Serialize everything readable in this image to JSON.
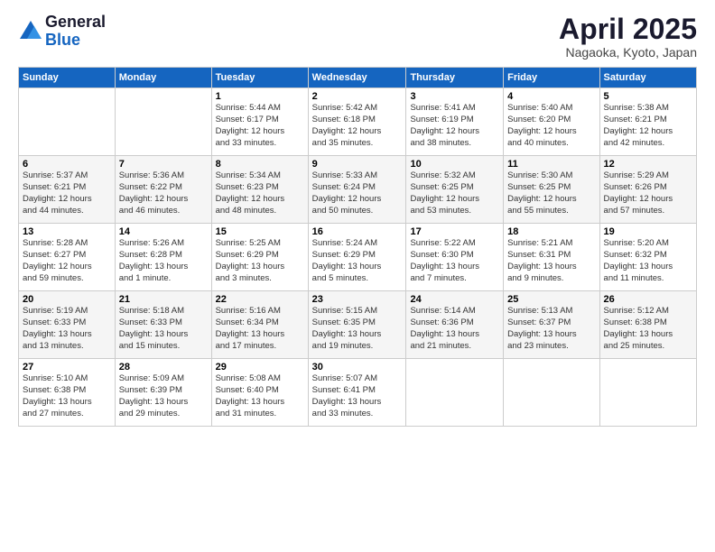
{
  "logo": {
    "general": "General",
    "blue": "Blue"
  },
  "header": {
    "title": "April 2025",
    "location": "Nagaoka, Kyoto, Japan"
  },
  "weekdays": [
    "Sunday",
    "Monday",
    "Tuesday",
    "Wednesday",
    "Thursday",
    "Friday",
    "Saturday"
  ],
  "weeks": [
    [
      null,
      null,
      {
        "day": "1",
        "sunrise": "Sunrise: 5:44 AM",
        "sunset": "Sunset: 6:17 PM",
        "daylight": "Daylight: 12 hours",
        "minutes": "and 33 minutes."
      },
      {
        "day": "2",
        "sunrise": "Sunrise: 5:42 AM",
        "sunset": "Sunset: 6:18 PM",
        "daylight": "Daylight: 12 hours",
        "minutes": "and 35 minutes."
      },
      {
        "day": "3",
        "sunrise": "Sunrise: 5:41 AM",
        "sunset": "Sunset: 6:19 PM",
        "daylight": "Daylight: 12 hours",
        "minutes": "and 38 minutes."
      },
      {
        "day": "4",
        "sunrise": "Sunrise: 5:40 AM",
        "sunset": "Sunset: 6:20 PM",
        "daylight": "Daylight: 12 hours",
        "minutes": "and 40 minutes."
      },
      {
        "day": "5",
        "sunrise": "Sunrise: 5:38 AM",
        "sunset": "Sunset: 6:21 PM",
        "daylight": "Daylight: 12 hours",
        "minutes": "and 42 minutes."
      }
    ],
    [
      {
        "day": "6",
        "sunrise": "Sunrise: 5:37 AM",
        "sunset": "Sunset: 6:21 PM",
        "daylight": "Daylight: 12 hours",
        "minutes": "and 44 minutes."
      },
      {
        "day": "7",
        "sunrise": "Sunrise: 5:36 AM",
        "sunset": "Sunset: 6:22 PM",
        "daylight": "Daylight: 12 hours",
        "minutes": "and 46 minutes."
      },
      {
        "day": "8",
        "sunrise": "Sunrise: 5:34 AM",
        "sunset": "Sunset: 6:23 PM",
        "daylight": "Daylight: 12 hours",
        "minutes": "and 48 minutes."
      },
      {
        "day": "9",
        "sunrise": "Sunrise: 5:33 AM",
        "sunset": "Sunset: 6:24 PM",
        "daylight": "Daylight: 12 hours",
        "minutes": "and 50 minutes."
      },
      {
        "day": "10",
        "sunrise": "Sunrise: 5:32 AM",
        "sunset": "Sunset: 6:25 PM",
        "daylight": "Daylight: 12 hours",
        "minutes": "and 53 minutes."
      },
      {
        "day": "11",
        "sunrise": "Sunrise: 5:30 AM",
        "sunset": "Sunset: 6:25 PM",
        "daylight": "Daylight: 12 hours",
        "minutes": "and 55 minutes."
      },
      {
        "day": "12",
        "sunrise": "Sunrise: 5:29 AM",
        "sunset": "Sunset: 6:26 PM",
        "daylight": "Daylight: 12 hours",
        "minutes": "and 57 minutes."
      }
    ],
    [
      {
        "day": "13",
        "sunrise": "Sunrise: 5:28 AM",
        "sunset": "Sunset: 6:27 PM",
        "daylight": "Daylight: 12 hours",
        "minutes": "and 59 minutes."
      },
      {
        "day": "14",
        "sunrise": "Sunrise: 5:26 AM",
        "sunset": "Sunset: 6:28 PM",
        "daylight": "Daylight: 13 hours",
        "minutes": "and 1 minute."
      },
      {
        "day": "15",
        "sunrise": "Sunrise: 5:25 AM",
        "sunset": "Sunset: 6:29 PM",
        "daylight": "Daylight: 13 hours",
        "minutes": "and 3 minutes."
      },
      {
        "day": "16",
        "sunrise": "Sunrise: 5:24 AM",
        "sunset": "Sunset: 6:29 PM",
        "daylight": "Daylight: 13 hours",
        "minutes": "and 5 minutes."
      },
      {
        "day": "17",
        "sunrise": "Sunrise: 5:22 AM",
        "sunset": "Sunset: 6:30 PM",
        "daylight": "Daylight: 13 hours",
        "minutes": "and 7 minutes."
      },
      {
        "day": "18",
        "sunrise": "Sunrise: 5:21 AM",
        "sunset": "Sunset: 6:31 PM",
        "daylight": "Daylight: 13 hours",
        "minutes": "and 9 minutes."
      },
      {
        "day": "19",
        "sunrise": "Sunrise: 5:20 AM",
        "sunset": "Sunset: 6:32 PM",
        "daylight": "Daylight: 13 hours",
        "minutes": "and 11 minutes."
      }
    ],
    [
      {
        "day": "20",
        "sunrise": "Sunrise: 5:19 AM",
        "sunset": "Sunset: 6:33 PM",
        "daylight": "Daylight: 13 hours",
        "minutes": "and 13 minutes."
      },
      {
        "day": "21",
        "sunrise": "Sunrise: 5:18 AM",
        "sunset": "Sunset: 6:33 PM",
        "daylight": "Daylight: 13 hours",
        "minutes": "and 15 minutes."
      },
      {
        "day": "22",
        "sunrise": "Sunrise: 5:16 AM",
        "sunset": "Sunset: 6:34 PM",
        "daylight": "Daylight: 13 hours",
        "minutes": "and 17 minutes."
      },
      {
        "day": "23",
        "sunrise": "Sunrise: 5:15 AM",
        "sunset": "Sunset: 6:35 PM",
        "daylight": "Daylight: 13 hours",
        "minutes": "and 19 minutes."
      },
      {
        "day": "24",
        "sunrise": "Sunrise: 5:14 AM",
        "sunset": "Sunset: 6:36 PM",
        "daylight": "Daylight: 13 hours",
        "minutes": "and 21 minutes."
      },
      {
        "day": "25",
        "sunrise": "Sunrise: 5:13 AM",
        "sunset": "Sunset: 6:37 PM",
        "daylight": "Daylight: 13 hours",
        "minutes": "and 23 minutes."
      },
      {
        "day": "26",
        "sunrise": "Sunrise: 5:12 AM",
        "sunset": "Sunset: 6:38 PM",
        "daylight": "Daylight: 13 hours",
        "minutes": "and 25 minutes."
      }
    ],
    [
      {
        "day": "27",
        "sunrise": "Sunrise: 5:10 AM",
        "sunset": "Sunset: 6:38 PM",
        "daylight": "Daylight: 13 hours",
        "minutes": "and 27 minutes."
      },
      {
        "day": "28",
        "sunrise": "Sunrise: 5:09 AM",
        "sunset": "Sunset: 6:39 PM",
        "daylight": "Daylight: 13 hours",
        "minutes": "and 29 minutes."
      },
      {
        "day": "29",
        "sunrise": "Sunrise: 5:08 AM",
        "sunset": "Sunset: 6:40 PM",
        "daylight": "Daylight: 13 hours",
        "minutes": "and 31 minutes."
      },
      {
        "day": "30",
        "sunrise": "Sunrise: 5:07 AM",
        "sunset": "Sunset: 6:41 PM",
        "daylight": "Daylight: 13 hours",
        "minutes": "and 33 minutes."
      },
      null,
      null,
      null
    ]
  ]
}
